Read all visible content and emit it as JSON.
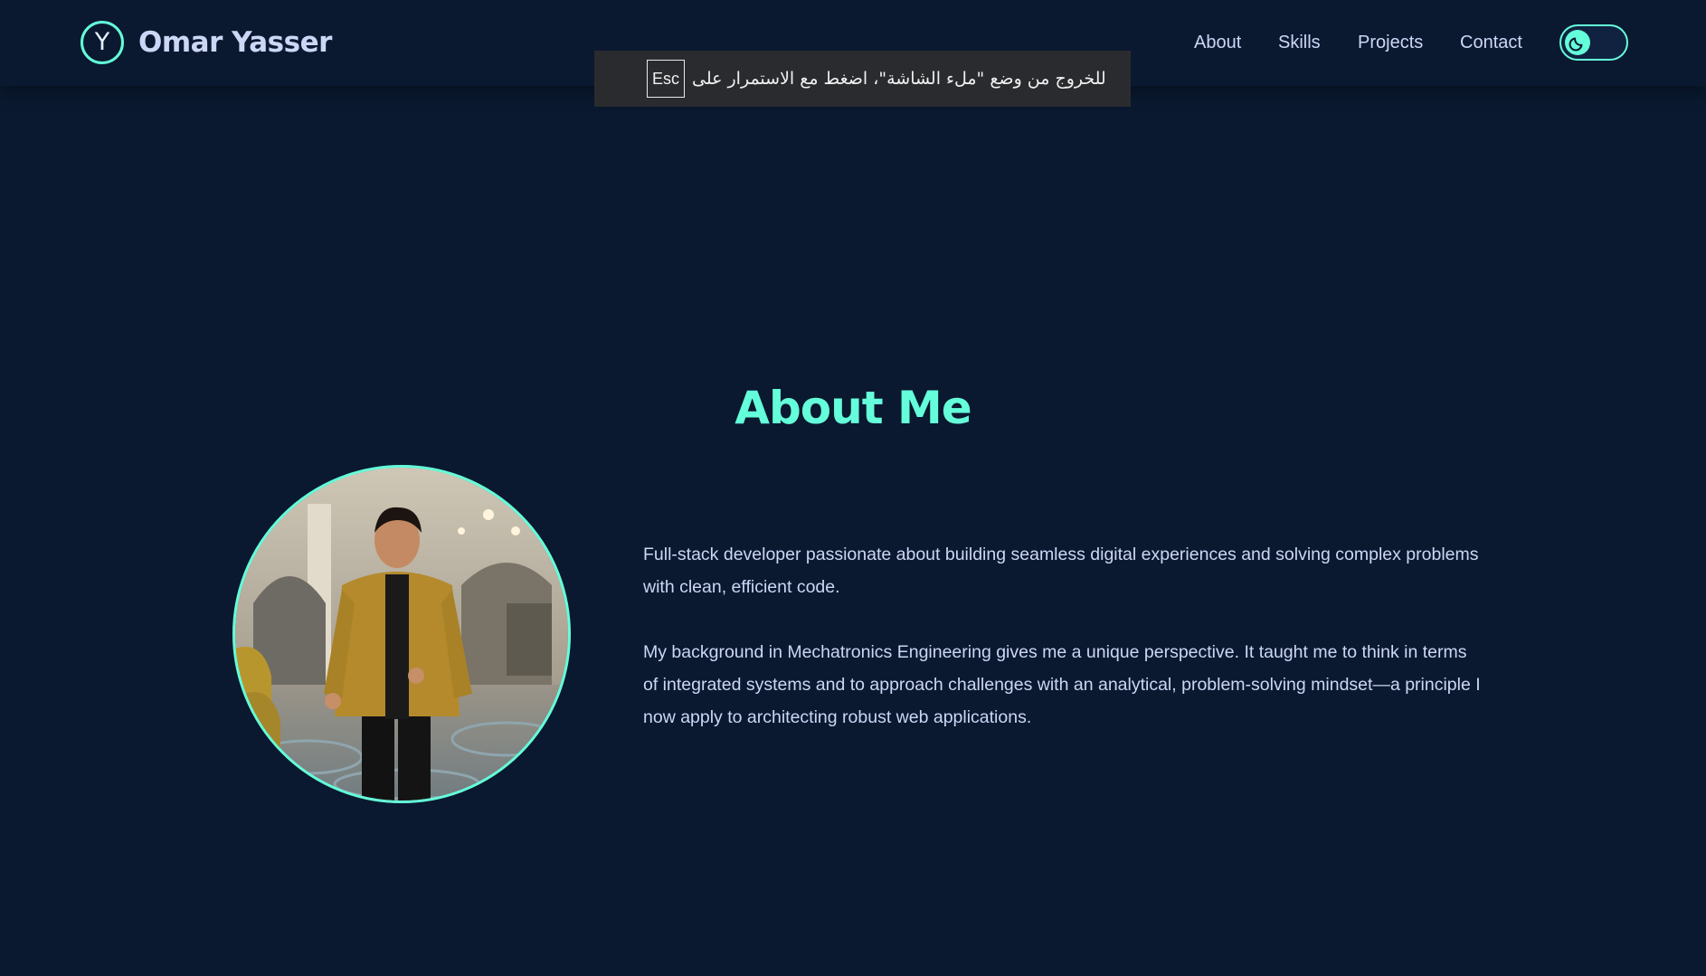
{
  "header": {
    "logo_letter": "Y",
    "brand_name": "Omar Yasser",
    "nav": [
      {
        "label": "About"
      },
      {
        "label": "Skills"
      },
      {
        "label": "Projects"
      },
      {
        "label": "Contact"
      }
    ],
    "theme_toggle": {
      "icon": "moon-icon",
      "mode": "dark"
    }
  },
  "fullscreen_notice": {
    "key_label": "Esc",
    "text": "للخروج من وضع \"ملء الشاشة\"، اضغط مع الاستمرار على"
  },
  "about": {
    "title": "About Me",
    "paragraphs": [
      "Full-stack developer passionate about building seamless digital experiences and solving complex problems with clean, efficient code.",
      "My background in Mechatronics Engineering gives me a unique perspective. It taught me to think in terms of integrated systems and to approach challenges with an analytical, problem-solving mindset—a principle I now apply to architecting robust web applications."
    ]
  },
  "colors": {
    "background": "#0a192f",
    "accent": "#64ffda",
    "text": "#ccd6f6"
  }
}
